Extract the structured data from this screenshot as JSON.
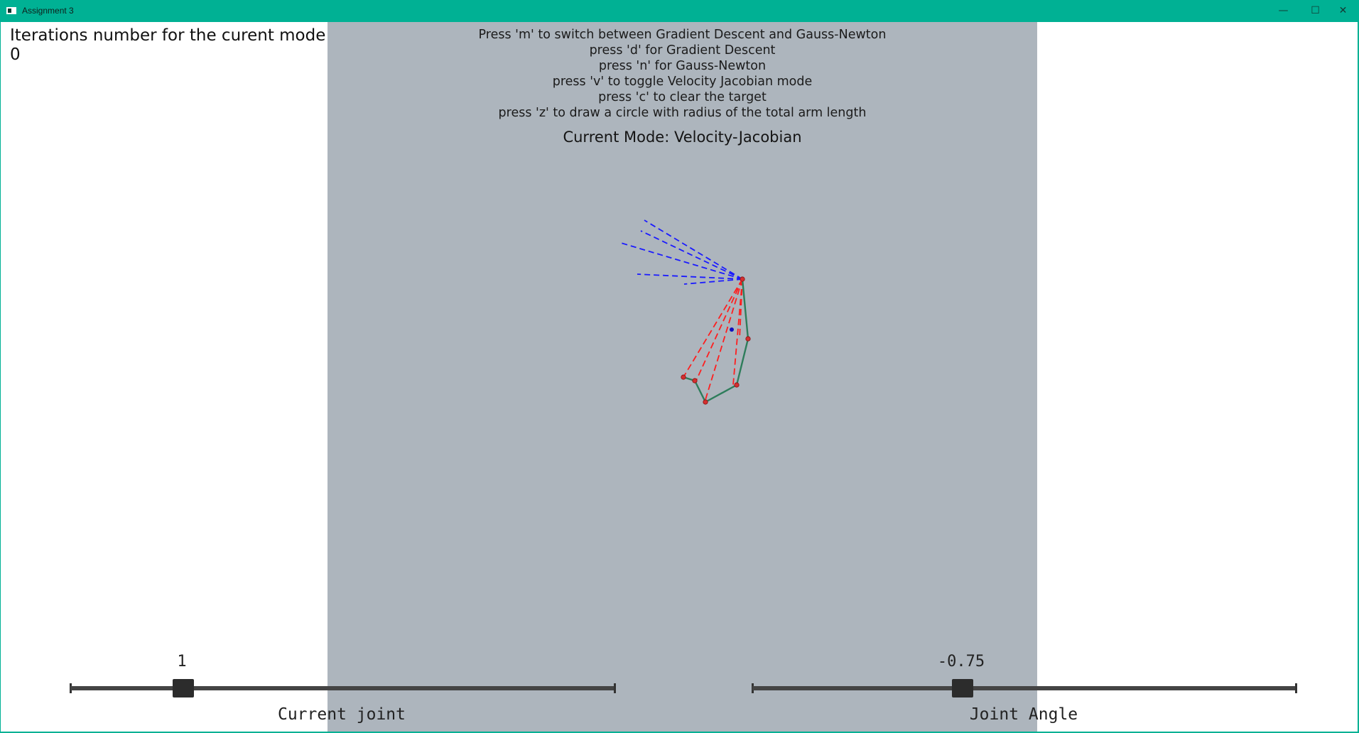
{
  "window": {
    "title": "Assignment 3",
    "minimize_glyph": "—",
    "maximize_glyph": "☐",
    "close_glyph": "✕"
  },
  "status": {
    "iterations_label": "Iterations number for the curent mode:",
    "iterations_value": "0"
  },
  "instructions": [
    "Press 'm' to switch between Gradient Descent and Gauss-Newton",
    "press 'd' for Gradient Descent",
    "press 'n' for Gauss-Newton",
    "press 'v' to toggle Velocity Jacobian mode",
    "press 'c' to clear the target",
    "press 'z' to draw a circle with radius of the total arm length"
  ],
  "mode": {
    "current_mode": "Current Mode: Velocity-Jacobian"
  },
  "sliders": {
    "current_joint": {
      "value_text": "1",
      "caption": "Current joint",
      "fraction": 0.207
    },
    "joint_angle": {
      "value_text": "-0.75",
      "caption": "Joint Angle",
      "fraction": 0.386
    }
  },
  "colors": {
    "titlebar": "#00b194",
    "canvas": "#adb5bd",
    "arm_link": "#2e7d5b",
    "joint": "#d32f2f",
    "jacobian_red": "#ff1e1e",
    "jacobian_blue": "#1a1aff",
    "target": "#1010c0"
  }
}
